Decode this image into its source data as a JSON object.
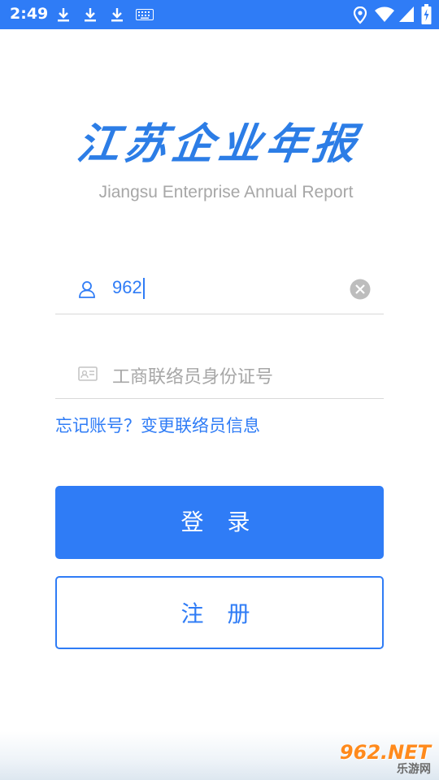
{
  "status_bar": {
    "time": "2:49",
    "icons": [
      "download-icon",
      "download-icon",
      "download-icon",
      "keyboard-icon",
      "location-icon",
      "wifi-icon",
      "signal-icon",
      "battery-icon"
    ]
  },
  "logo": {
    "title": "江苏企业年报",
    "subtitle": "Jiangsu Enterprise Annual Report"
  },
  "form": {
    "account_value": "962",
    "id_placeholder": "工商联络员身份证号",
    "forgot_link": "忘记账号？变更联络员信息"
  },
  "buttons": {
    "login": "登 录",
    "register": "注 册"
  },
  "watermark": {
    "top": "962.NET",
    "bottom": "乐游网"
  },
  "colors": {
    "primary": "#2f7cf6",
    "placeholder": "#a7a7a7",
    "divider": "#d9d9d9"
  }
}
